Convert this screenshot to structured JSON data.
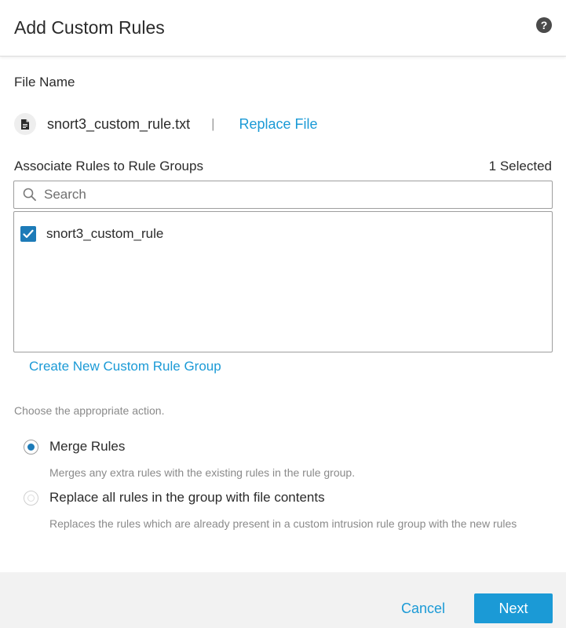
{
  "dialog": {
    "title": "Add Custom Rules",
    "help_icon": "question-circle-icon",
    "help_glyph": "?"
  },
  "file": {
    "label": "File Name",
    "icon": "file-icon",
    "name": "snort3_custom_rule.txt",
    "separator": "|",
    "replace_label": "Replace File"
  },
  "associate": {
    "label": "Associate Rules to Rule Groups",
    "selected_count": "1 Selected",
    "search_placeholder": "Search",
    "search_value": "",
    "items": [
      {
        "label": "snort3_custom_rule",
        "checked": true
      }
    ],
    "create_link": "Create New Custom Rule Group"
  },
  "action": {
    "prompt": "Choose the appropriate action.",
    "options": [
      {
        "label": "Merge Rules",
        "description": "Merges any extra rules with the existing rules in the rule group.",
        "selected": true
      },
      {
        "label": "Replace all rules in the group with file contents",
        "description": "Replaces the rules which are already present in a custom intrusion rule group with the new rules",
        "selected": false
      }
    ]
  },
  "footer": {
    "cancel_label": "Cancel",
    "next_label": "Next"
  },
  "colors": {
    "accent": "#1b9ad6",
    "checkbox": "#1d7bb8",
    "footer_bg": "#f2f2f2"
  }
}
